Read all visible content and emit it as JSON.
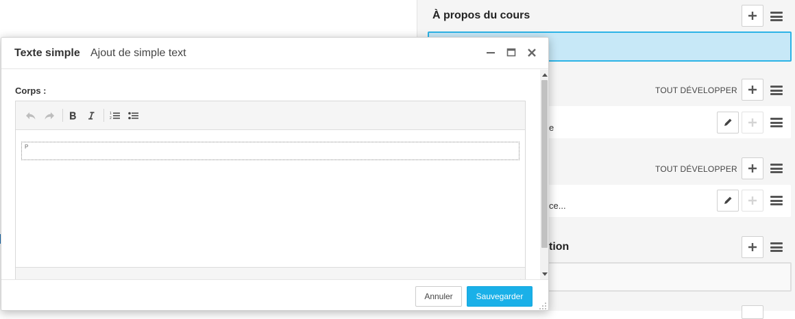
{
  "background": {
    "sections": [
      {
        "title": "À propos du cours"
      },
      {
        "expand_label": "TOUT DÉVELOPPER",
        "row_text": "e"
      },
      {
        "expand_label": "TOUT DÉVELOPPER",
        "row_text": "ce..."
      },
      {
        "title": "tion"
      }
    ],
    "icons": {
      "add": "plus-icon",
      "menu": "hamburger-icon",
      "edit": "pencil-icon"
    }
  },
  "modal": {
    "title": "Texte simple",
    "subtitle": "Ajout de simple text",
    "field_label": "Corps :",
    "editor_block_marker": "P",
    "cancel_label": "Annuler",
    "save_label": "Sauvegarder"
  },
  "colors": {
    "accent": "#1ab0e8",
    "highlight_fill": "#c7e8f7",
    "highlight_border": "#2bb3e6"
  }
}
